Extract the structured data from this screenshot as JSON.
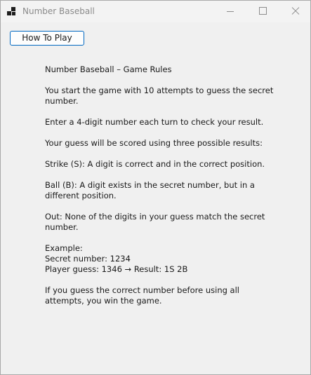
{
  "window": {
    "title": "Number Baseball",
    "app_icon": "app-icon",
    "controls": {
      "minimize_icon": "minimize-icon",
      "maximize_icon": "maximize-icon",
      "close_icon": "close-icon"
    }
  },
  "toolbar": {
    "how_to_play_label": "How To Play"
  },
  "rules": {
    "heading": "Number Baseball – Game Rules",
    "attempts": "You start the game with 10 attempts to guess the secret number.",
    "enter": "Enter a 4-digit number each turn to check your result.",
    "scoring": "Your guess will be scored using three possible results:",
    "strike": "Strike (S): A digit is correct and in the correct position.",
    "ball": "Ball (B): A digit exists in the secret number, but in a different position.",
    "out": "Out: None of the digits in your guess match the secret number.",
    "example_label": "Example:",
    "example_secret": "Secret number: 1234",
    "example_guess": "Player guess: 1346 → Result: 1S 2B",
    "win": "If you guess the correct number before using all attempts, you win the game."
  }
}
